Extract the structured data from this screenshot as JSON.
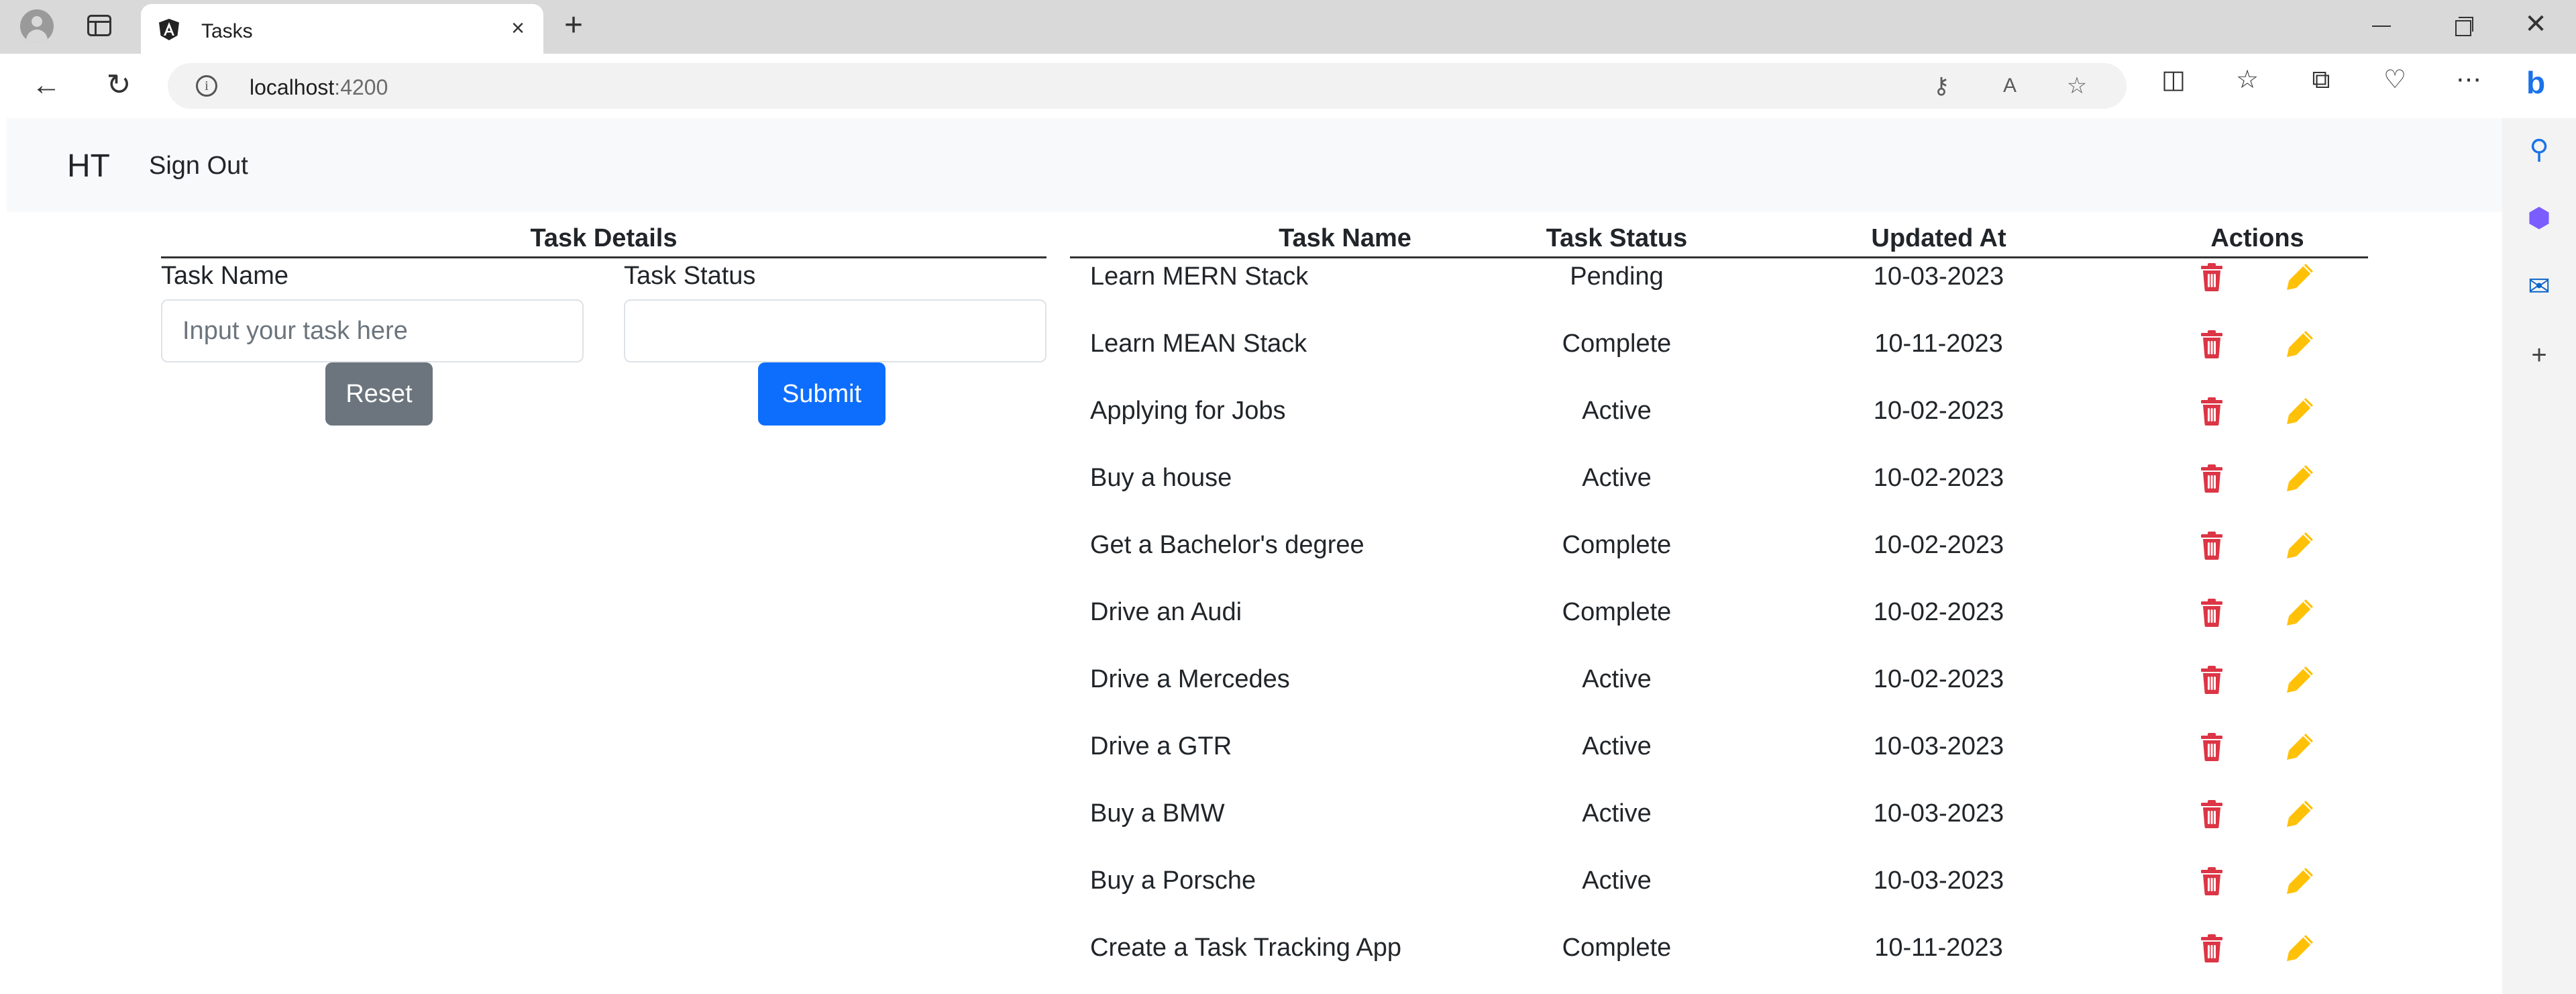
{
  "browser": {
    "tab_title": "Tasks",
    "url_host": "localhost",
    "url_port": ":4200"
  },
  "app": {
    "brand": "HT",
    "sign_out": "Sign Out"
  },
  "form": {
    "title": "Task Details",
    "task_name_label": "Task Name",
    "task_name_placeholder": "Input your task here",
    "task_name_value": "",
    "task_status_label": "Task Status",
    "task_status_value": "",
    "reset_label": "Reset",
    "submit_label": "Submit"
  },
  "table": {
    "headers": [
      "Task Name",
      "Task Status",
      "Updated At",
      "Actions"
    ],
    "rows": [
      {
        "name": "Learn MERN Stack",
        "status": "Pending",
        "updated": "10-03-2023"
      },
      {
        "name": "Learn MEAN Stack",
        "status": "Complete",
        "updated": "10-11-2023"
      },
      {
        "name": "Applying for Jobs",
        "status": "Active",
        "updated": "10-02-2023"
      },
      {
        "name": "Buy a house",
        "status": "Active",
        "updated": "10-02-2023"
      },
      {
        "name": "Get a Bachelor's degree",
        "status": "Complete",
        "updated": "10-02-2023"
      },
      {
        "name": "Drive an Audi",
        "status": "Complete",
        "updated": "10-02-2023"
      },
      {
        "name": "Drive a Mercedes",
        "status": "Active",
        "updated": "10-02-2023"
      },
      {
        "name": "Drive a GTR",
        "status": "Active",
        "updated": "10-03-2023"
      },
      {
        "name": "Buy a BMW",
        "status": "Active",
        "updated": "10-03-2023"
      },
      {
        "name": "Buy a Porsche",
        "status": "Active",
        "updated": "10-03-2023"
      },
      {
        "name": "Create a Task Tracking App",
        "status": "Complete",
        "updated": "10-11-2023"
      }
    ]
  },
  "icons": {
    "delete": "trash-icon",
    "edit": "pencil-icon"
  },
  "colors": {
    "delete": "#dc3545",
    "edit": "#ffc107",
    "reset_button": "#6c757d",
    "submit_button": "#0d6efd",
    "navbar": "#f8f9fa"
  }
}
